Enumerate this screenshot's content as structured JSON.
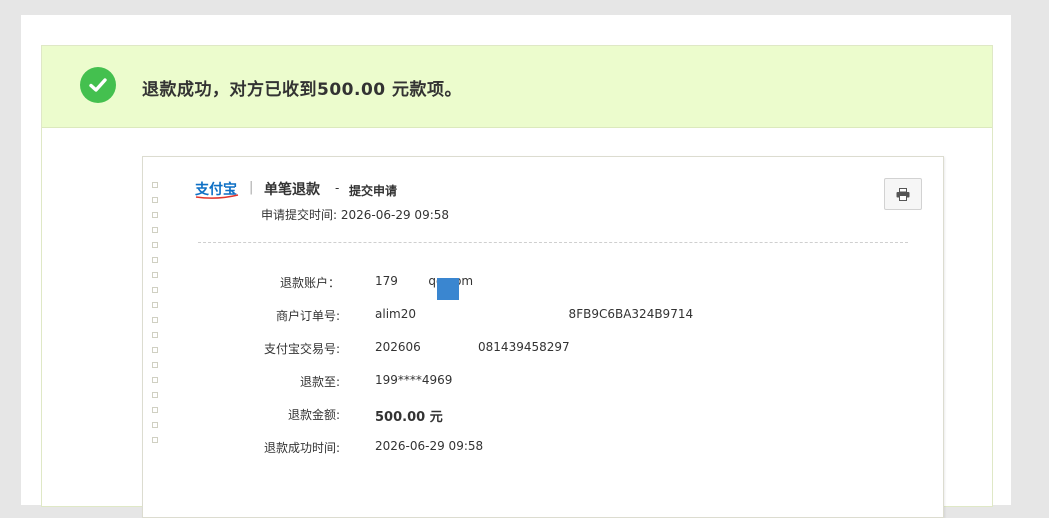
{
  "banner": {
    "prefix": "退款成功，对方已收到",
    "amount": "500.00",
    "suffix": " 元款项。"
  },
  "receipt": {
    "logo_text": "支付宝",
    "separator": "|",
    "type_title": "单笔退款",
    "dash": "-",
    "stage": "提交申请",
    "submit_time_label": "申请提交时间:",
    "submit_time": "2026-06-29 09:58",
    "fields": [
      {
        "label": "退款账户：",
        "value": "179        qq.com"
      },
      {
        "label": "商户订单号:",
        "value": "alim20                                        8FB9C6BA324B9714"
      },
      {
        "label": "支付宝交易号:",
        "value": "202606               081439458297"
      },
      {
        "label": "退款至:",
        "value": "199****4969"
      },
      {
        "label": "退款金额:",
        "value": "500.00 元"
      },
      {
        "label": "退款成功时间:",
        "value": "2026-06-29 09:58"
      }
    ]
  },
  "colors": {
    "banner_bg": "#ecfccd",
    "success_green": "#44c04f",
    "logo_blue": "#0e70c5"
  },
  "icons": {
    "success": "check-circle-icon",
    "print": "printer-icon"
  }
}
